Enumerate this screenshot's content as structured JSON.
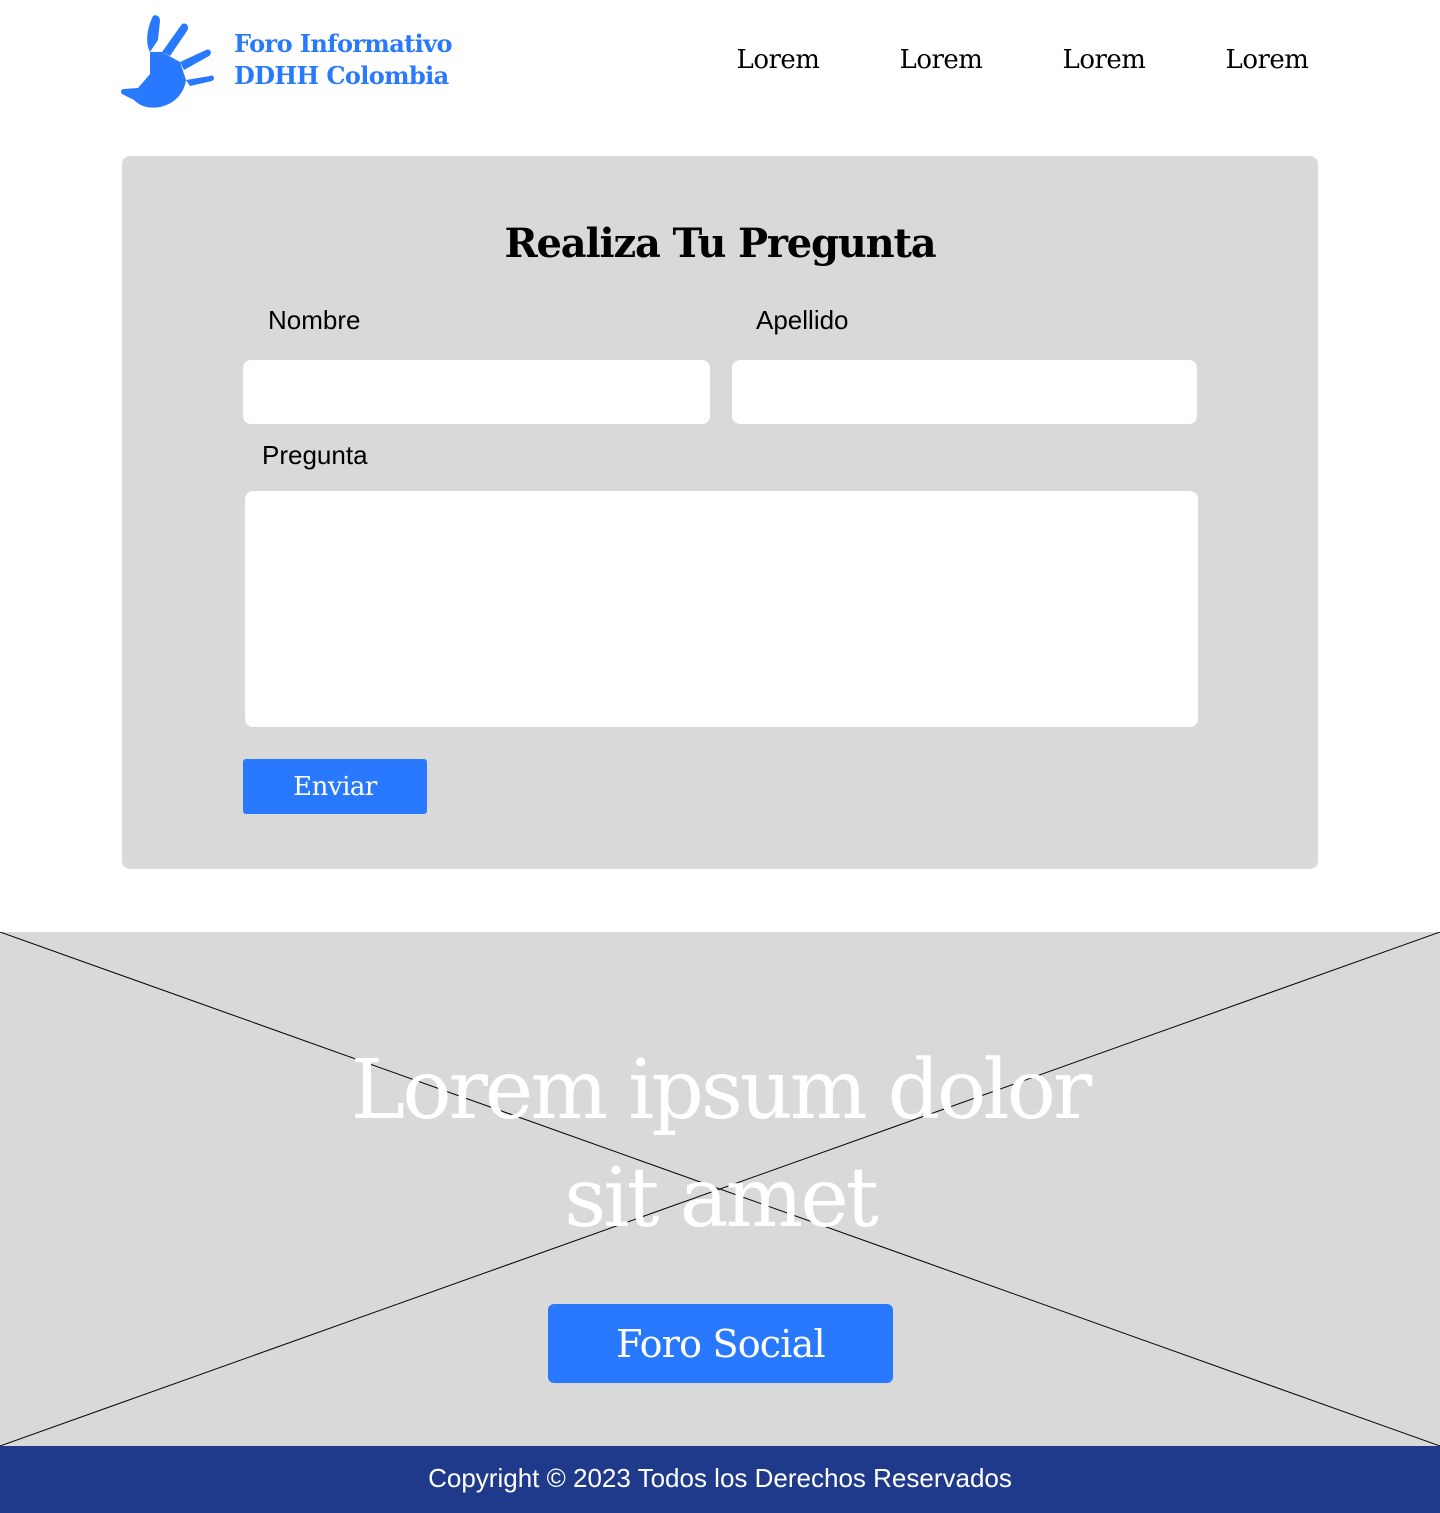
{
  "colors": {
    "brand": "#2979ff",
    "card_background": "#d9d9d9",
    "footer_background": "#1f3a8a"
  },
  "header": {
    "logo_icon": "hand-icon",
    "brand_line1": "Foro Informativo",
    "brand_line2": "DDHH Colombia",
    "nav": [
      "Lorem",
      "Lorem",
      "Lorem",
      "Lorem"
    ]
  },
  "form": {
    "title": "Realiza Tu Pregunta",
    "nombre_label": "Nombre",
    "nombre_value": "",
    "apellido_label": "Apellido",
    "apellido_value": "",
    "pregunta_label": "Pregunta",
    "pregunta_value": "",
    "submit_label": "Enviar"
  },
  "hero": {
    "image_placeholder_icon": "image-placeholder-icon",
    "title_line1": "Lorem ipsum dolor",
    "title_line2": "sit amet",
    "button_label": "Foro Social"
  },
  "footer": {
    "copyright": "Copyright © 2023 Todos los Derechos Reservados"
  }
}
